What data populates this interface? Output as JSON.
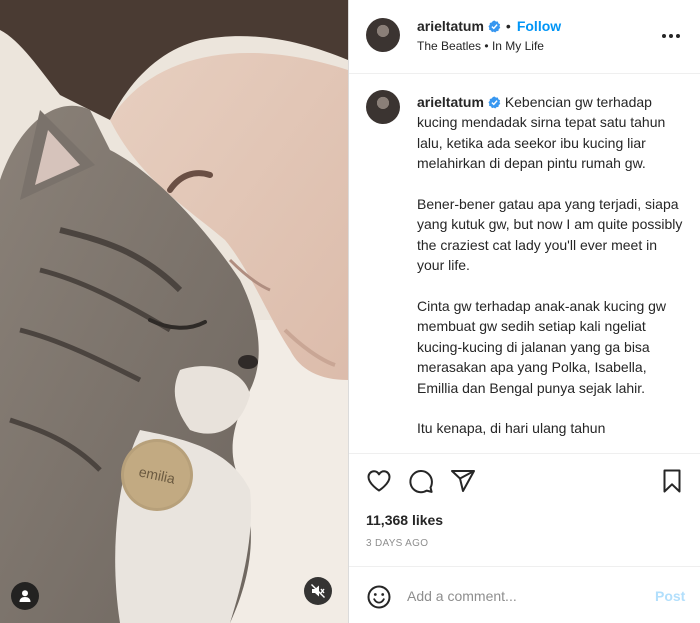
{
  "post": {
    "username": "arieltatum",
    "follow_label": "Follow",
    "separator": "•",
    "audio_artist": "The Beatles",
    "audio_sep": "•",
    "audio_title": "In My Life",
    "tag_text": "emilia",
    "caption": {
      "p1": "Kebencian gw terhadap kucing mendadak sirna tepat satu tahun lalu, ketika ada seekor ibu kucing liar melahirkan di depan pintu rumah gw.",
      "p2": "Bener-bener gatau apa yang terjadi, siapa yang kutuk gw, but now I am quite possibly the craziest cat lady you'll ever meet in your life.",
      "p3": "Cinta gw terhadap anak-anak kucing gw membuat gw sedih setiap kali ngeliat kucing-kucing di jalanan yang ga bisa merasakan apa yang Polka, Isabella, Emillia dan Bengal punya sejak lahir.",
      "p4": "Itu kenapa, di hari ulang tahun"
    },
    "likes": "11,368 likes",
    "date": "3 DAYS AGO",
    "comment_placeholder": "Add a comment...",
    "post_label": "Post"
  },
  "icons": [
    "user-tag-icon",
    "mute-icon",
    "verified-icon",
    "more-icon",
    "heart-icon",
    "comment-icon",
    "share-icon",
    "bookmark-icon",
    "emoji-icon"
  ],
  "colors": {
    "link": "#0095f6",
    "post_disabled": "#b2dffc",
    "muted_text": "#8e8e8e",
    "verified": "#3897f0"
  }
}
